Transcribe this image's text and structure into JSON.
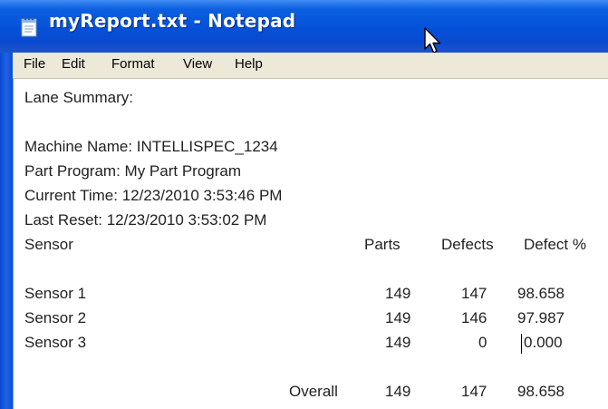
{
  "window": {
    "title": "myReport.txt - Notepad"
  },
  "menu": {
    "items": [
      "File",
      "Edit",
      "Format",
      "View",
      "Help"
    ]
  },
  "report": {
    "heading": "Lane Summary:",
    "machine_name": "Machine Name: INTELLISPEC_1234",
    "part_program": "Part Program: My Part Program",
    "current_time": "Current Time: 12/23/2010 3:53:46 PM",
    "last_reset": "Last Reset: 12/23/2010 3:53:02 PM",
    "table_headers": [
      "Sensor",
      "Parts",
      "Defects",
      "Defect %"
    ],
    "rows": [
      {
        "sensor": "Sensor 1",
        "parts": "149",
        "defects": "147",
        "defect_pct": "98.658"
      },
      {
        "sensor": "Sensor 2",
        "parts": "149",
        "defects": "146",
        "defect_pct": "97.987"
      },
      {
        "sensor": "Sensor 3",
        "parts": "149",
        "defects": "0",
        "defect_pct": "0.000"
      }
    ],
    "overall": {
      "label": "Overall",
      "parts": "149",
      "defects": "147",
      "defect_pct": "98.658"
    }
  },
  "colors": {
    "titlebar": "#0550d8",
    "menubar": "#ece9d8",
    "text": "#222222"
  },
  "icons": {
    "app": "notepad-icon",
    "pointer": "mouse-cursor-icon"
  }
}
